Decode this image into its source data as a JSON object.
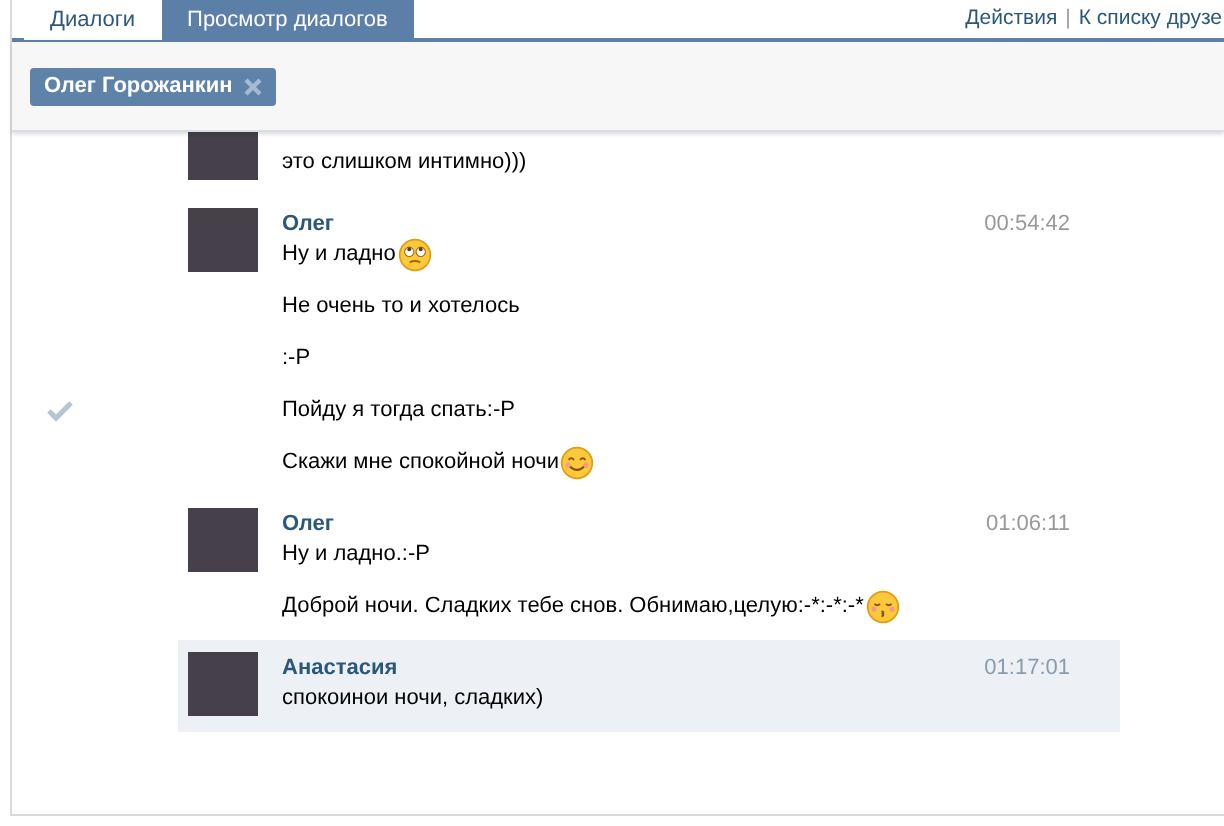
{
  "tabs": [
    {
      "label": "Диалоги",
      "selected": false
    },
    {
      "label": "Просмотр диалогов",
      "selected": true
    }
  ],
  "links": [
    "Действия",
    "К списку друзе"
  ],
  "link_separator": "|",
  "participant_chip": {
    "name": "Олег Горожанкин"
  },
  "messages": [
    {
      "selected": false,
      "lines": [
        {
          "kind": "text",
          "text": "это слишком интимно)))",
          "checked": false
        }
      ]
    },
    {
      "author": "Олег",
      "time": "00:54:42",
      "selected": false,
      "lines": [
        {
          "kind": "rolleyes",
          "text": "Ну и ладно",
          "checked": false
        },
        {
          "kind": "text",
          "text": "Не очень то и хотелось",
          "checked": false
        },
        {
          "kind": "text",
          "text": ":-P",
          "checked": false
        },
        {
          "kind": "text",
          "text": "Пойду я тогда спать:-P",
          "checked": true
        },
        {
          "kind": "smile",
          "text": "Скажи мне спокойной ночи",
          "checked": false
        }
      ]
    },
    {
      "author": "Олег",
      "time": "01:06:11",
      "selected": false,
      "lines": [
        {
          "kind": "text",
          "text": "Ну и ладно.:-P",
          "checked": false
        },
        {
          "kind": "kiss",
          "text": "Доброй ночи. Сладких тебе снов. Обнимаю,целую:-*:-*:-*",
          "checked": false
        }
      ]
    },
    {
      "author": "Анастасия",
      "time": "01:17:01",
      "selected": true,
      "lines": [
        {
          "kind": "text",
          "text": "спокоинои ночи, сладких)",
          "checked": false
        }
      ]
    }
  ]
}
